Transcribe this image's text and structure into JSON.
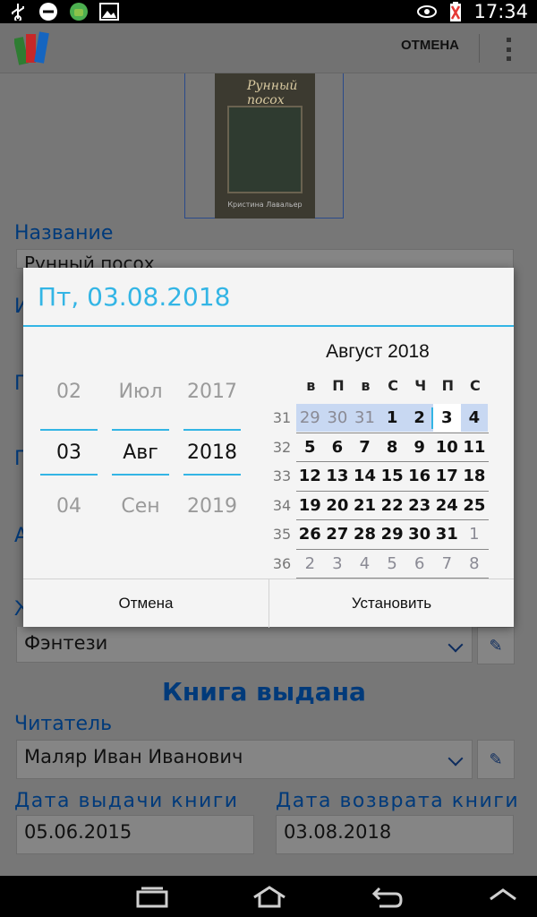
{
  "status_bar": {
    "time": "17:34",
    "icons_left": [
      "usb-icon",
      "do-not-disturb-icon",
      "android-icon",
      "image-icon"
    ],
    "icons_right": [
      "eye-icon",
      "battery-icon"
    ]
  },
  "action_bar": {
    "cancel_label": "ОТМЕНА",
    "menu_icon": "overflow-menu-icon"
  },
  "form": {
    "cover_title": "Рунный посох",
    "cover_author": "Кристина Лавальер",
    "name_label": "Название",
    "name_value": "Рунный посох",
    "genre_value": "Фэнтези",
    "section_title": "Книга выдана",
    "reader_label": "Читатель",
    "reader_value": "Маляр Иван Иванович",
    "issue_date_label": "Дата выдачи книги",
    "issue_date_value": "05.06.2015",
    "return_date_label": "Дата возврата книги",
    "return_date_value": "03.08.2018",
    "hidden_label_letters": [
      "И",
      "П",
      "П",
      "А",
      "Ж"
    ]
  },
  "dialog": {
    "title": "Пт, 03.08.2018",
    "day_spinner": {
      "prev": "02",
      "current": "03",
      "next": "04"
    },
    "month_spinner": {
      "prev": "Июл",
      "current": "Авг",
      "next": "Сен"
    },
    "year_spinner": {
      "prev": "2017",
      "current": "2018",
      "next": "2019"
    },
    "calendar": {
      "month_label": "Август 2018",
      "weekdays": [
        "в",
        "П",
        "в",
        "С",
        "Ч",
        "П",
        "С"
      ],
      "weeks": [
        {
          "week": "31",
          "days": [
            "29",
            "30",
            "31",
            "1",
            "2",
            "3",
            "4"
          ]
        },
        {
          "week": "32",
          "days": [
            "5",
            "6",
            "7",
            "8",
            "9",
            "10",
            "11"
          ]
        },
        {
          "week": "33",
          "days": [
            "12",
            "13",
            "14",
            "15",
            "16",
            "17",
            "18"
          ]
        },
        {
          "week": "34",
          "days": [
            "19",
            "20",
            "21",
            "22",
            "23",
            "24",
            "25"
          ]
        },
        {
          "week": "35",
          "days": [
            "26",
            "27",
            "28",
            "29",
            "30",
            "31",
            "1"
          ]
        },
        {
          "week": "36",
          "days": [
            "2",
            "3",
            "4",
            "5",
            "6",
            "7",
            "8"
          ]
        }
      ],
      "selected_day": "3"
    },
    "cancel_label": "Отмена",
    "set_label": "Установить"
  },
  "colors": {
    "accent": "#33b5e5",
    "label_blue": "#003a7a",
    "week_highlight": "#c8d8f2"
  }
}
